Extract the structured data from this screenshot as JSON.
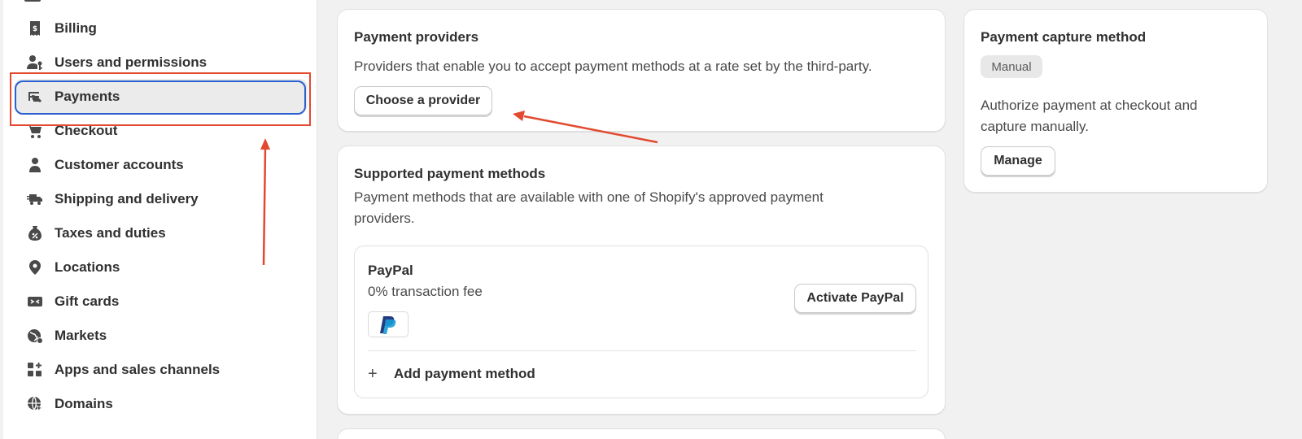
{
  "sidebar": {
    "items": [
      {
        "label": "Billing",
        "icon": "billing-icon"
      },
      {
        "label": "Users and permissions",
        "icon": "users-icon"
      },
      {
        "label": "Payments",
        "icon": "payments-icon",
        "active": true
      },
      {
        "label": "Checkout",
        "icon": "cart-icon"
      },
      {
        "label": "Customer accounts",
        "icon": "person-icon"
      },
      {
        "label": "Shipping and delivery",
        "icon": "truck-icon"
      },
      {
        "label": "Taxes and duties",
        "icon": "tax-icon"
      },
      {
        "label": "Locations",
        "icon": "location-pin-icon"
      },
      {
        "label": "Gift cards",
        "icon": "gift-card-icon"
      },
      {
        "label": "Markets",
        "icon": "globe-icon"
      },
      {
        "label": "Apps and sales channels",
        "icon": "apps-icon"
      },
      {
        "label": "Domains",
        "icon": "domain-globe-icon"
      }
    ]
  },
  "providers": {
    "title": "Payment providers",
    "description": "Providers that enable you to accept payment methods at a rate set by the third-party.",
    "button": "Choose a provider"
  },
  "supported": {
    "title": "Supported payment methods",
    "description_line1": "Payment methods that are available with one of Shopify's approved payment",
    "description_line2": "providers.",
    "paypal": {
      "name": "PayPal",
      "fee": "0% transaction fee",
      "button": "Activate PayPal"
    },
    "add_label": "Add payment method"
  },
  "capture": {
    "title": "Payment capture method",
    "badge": "Manual",
    "description_line1": "Authorize payment at checkout and",
    "description_line2": "capture manually.",
    "button": "Manage"
  },
  "colors": {
    "annotation": "#e2492f",
    "focus_ring": "#2c5fd0",
    "paypal_dark": "#253b80",
    "paypal_light": "#179bd7"
  }
}
